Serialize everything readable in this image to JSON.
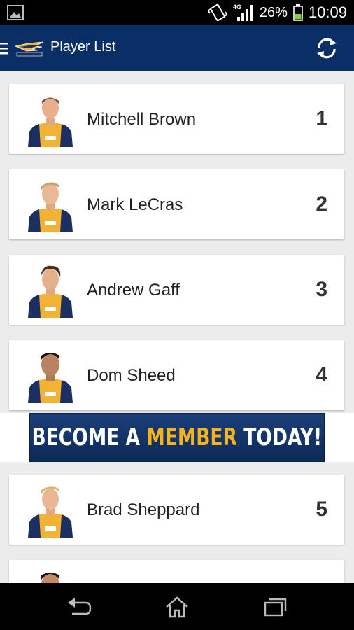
{
  "status_bar": {
    "network": "4G",
    "battery": "26%",
    "time": "10:09"
  },
  "app_bar": {
    "title": "Player List"
  },
  "players": [
    {
      "name": "Mitchell Brown",
      "number": "1"
    },
    {
      "name": "Mark LeCras",
      "number": "2"
    },
    {
      "name": "Andrew Gaff",
      "number": "3"
    },
    {
      "name": "Dom Sheed",
      "number": "4"
    },
    {
      "name": "Brad Sheppard",
      "number": "5"
    },
    {
      "name": "",
      "number": ""
    }
  ],
  "banner": {
    "part1": "BECOME A ",
    "part2": "MEMBER",
    "part3": " TODAY!"
  },
  "colors": {
    "app_bar": "#0a2f66",
    "banner_accent": "#f5b41a",
    "guernsey_gold": "#f2b233",
    "guernsey_navy": "#1b2f63"
  }
}
